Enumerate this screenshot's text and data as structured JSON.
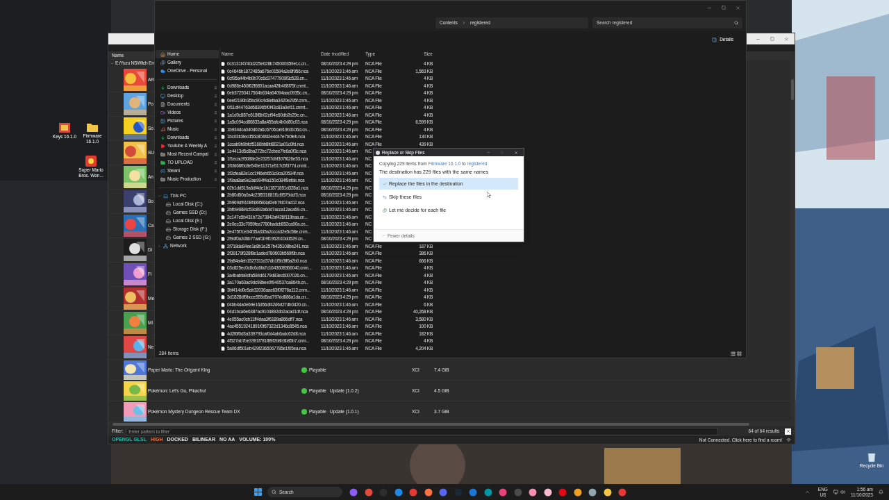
{
  "desktop_icons": [
    {
      "label": "Keys 16.1.0",
      "kind": "keys"
    },
    {
      "label": "Firmware 16.1.0",
      "kind": "folder"
    },
    {
      "label": "Super Mario Bros. Won...",
      "kind": "game"
    },
    {
      "label": "Recycle Bin",
      "kind": "bin"
    }
  ],
  "yuzu": {
    "header": "Name",
    "tree_root": "E:/Yuzu NSWitch En",
    "games_behind": [
      {
        "title": "AR"
      },
      {
        "title": "Po"
      },
      {
        "title": "So"
      },
      {
        "title": "SU"
      },
      {
        "title": "An"
      },
      {
        "title": "Bo"
      },
      {
        "title": "Ca"
      },
      {
        "title": "Di"
      },
      {
        "title": "Fi"
      },
      {
        "title": "Me"
      },
      {
        "title": "Mi"
      },
      {
        "title": "Ne"
      }
    ],
    "games": [
      {
        "title": "Paper Mario: The Origami King",
        "compatibility": "Playable",
        "color": "#43c443",
        "file_type": "XCI",
        "size": "7.4 GiB"
      },
      {
        "title": "Pokémon: Let's Go, Pikachu!",
        "compatibility": "Playable",
        "color": "#43c443",
        "addons": "Update (1.0.2)",
        "file_type": "XCI",
        "size": "4.5 GiB"
      },
      {
        "title": "Pokémon Mystery Dungeon Rescue Team DX",
        "compatibility": "Playable",
        "color": "#43c443",
        "addons": "Update (1.0.1)",
        "file_type": "XCI",
        "size": "3.7 GiB"
      }
    ],
    "filter": {
      "label": "Filter:",
      "placeholder": "Enter pattern to filter",
      "results": "64 of 64 results"
    },
    "status": [
      {
        "text": "OPENGL GLSL",
        "color": "#2fb6a8"
      },
      {
        "text": "HIGH",
        "color": "#e8713a"
      },
      {
        "text": "DOCKED",
        "color": "#e6e6e6"
      },
      {
        "text": "BILINEAR",
        "color": "#e6e6e6"
      },
      {
        "text": "NO AA",
        "color": "#e6e6e6"
      },
      {
        "text": "VOLUME: 100%",
        "color": "#e6e6e6"
      }
    ],
    "network": "Not Connected. Click here to find a room!"
  },
  "explorer": {
    "breadcrumb": [
      "Contents",
      "registered"
    ],
    "search_placeholder": "Search registered",
    "details_button": "Details",
    "sidebar": {
      "items": [
        {
          "label": "Home",
          "kind": "home",
          "selected": true,
          "pinned": false
        },
        {
          "label": "Gallery",
          "kind": "gallery",
          "selected": false,
          "pinned": false
        },
        {
          "label": "OneDrive - Personal",
          "kind": "cloud",
          "selected": false,
          "pinned": false
        },
        {
          "label": "Downloads",
          "kind": "download",
          "selected": false,
          "pinned": true
        },
        {
          "label": "Desktop",
          "kind": "desktop",
          "selected": false,
          "pinned": true
        },
        {
          "label": "Documents",
          "kind": "documents",
          "selected": false,
          "pinned": true
        },
        {
          "label": "Videos",
          "kind": "videos",
          "selected": false,
          "pinned": true
        },
        {
          "label": "Pictures",
          "kind": "pictures",
          "selected": false,
          "pinned": true
        },
        {
          "label": "Music",
          "kind": "music",
          "selected": false,
          "pinned": true
        },
        {
          "label": "Downloads",
          "kind": "download",
          "selected": false,
          "pinned": true
        },
        {
          "label": "Youtube & Weebly A",
          "kind": "video_folder",
          "selected": false,
          "pinned": true
        },
        {
          "label": "Most Recent Campai",
          "kind": "folder",
          "selected": false,
          "pinned": true
        },
        {
          "label": "TO UPLOAD",
          "kind": "green_folder",
          "selected": false,
          "pinned": true
        },
        {
          "label": "Steam",
          "kind": "steam",
          "selected": false,
          "pinned": true
        },
        {
          "label": "Music Production",
          "kind": "folder",
          "selected": false,
          "pinned": true
        }
      ],
      "tree": [
        {
          "label": "This PC",
          "kind": "pc",
          "expanded": true,
          "children": [
            {
              "label": "Local Disk (C:)"
            },
            {
              "label": "Games SSD (D:)"
            },
            {
              "label": "Local Disk (E:)"
            },
            {
              "label": "Storage Disk (F:)"
            },
            {
              "label": "Games 2 SSD (G:)"
            }
          ]
        },
        {
          "label": "Network",
          "kind": "network",
          "expanded": false
        }
      ]
    },
    "columns": [
      "Name",
      "Date modified",
      "Type",
      "Size"
    ],
    "files": [
      {
        "name": "0c3131f4740d225e028b745000359e1c.cn...",
        "date": "08/10/2023 4:29 pm",
        "type": "NCA File",
        "size": "4 KB"
      },
      {
        "name": "0c4646b1872485a676e01584a2e8f956.nca",
        "date": "11/10/2023 1:46 am",
        "type": "NCA File",
        "size": "1,563 KB"
      },
      {
        "name": "0cf95a44b4b0b70c6d37477909f3c528.cn...",
        "date": "11/10/2023 1:46 am",
        "type": "NCA File",
        "size": "4 KB"
      },
      {
        "name": "0d986e450f62f6801acaa42fb408f75f.cnmt...",
        "date": "11/10/2023 1:46 am",
        "type": "NCA File",
        "size": "4 KB"
      },
      {
        "name": "0eb37253417564b634a64094aac0935c.cn...",
        "date": "08/10/2023 4:29 pm",
        "type": "NCA File",
        "size": "4 KB"
      },
      {
        "name": "0eef2190b35bc90c4d8efaa3420e295f.cnm...",
        "date": "11/10/2023 1:46 am",
        "type": "NCA File",
        "size": "4 KB"
      },
      {
        "name": "0f11df44763d683965f0f43c83a0ef11.cnmt...",
        "date": "11/10/2023 1:46 am",
        "type": "NCA File",
        "size": "4 KB"
      },
      {
        "name": "1a1d0c887e618f8b02cf94e60db2b29e.cn...",
        "date": "11/10/2023 1:46 am",
        "type": "NCA File",
        "size": "4 KB"
      },
      {
        "name": "1a5c094cd86833a8a455afc4b0d80c03.nca",
        "date": "08/10/2023 4:29 pm",
        "type": "NCA File",
        "size": "6,599 KB"
      },
      {
        "name": "1b934dca040d02a6c6706ca919b3106d.cn...",
        "date": "08/10/2023 4:29 pm",
        "type": "NCA File",
        "size": "4 KB"
      },
      {
        "name": "1bc03fc8ecd56c804fd2e4d47e7b0feb.nca",
        "date": "11/10/2023 1:46 am",
        "type": "NCA File",
        "size": "130 KB"
      },
      {
        "name": "1ccab9b9bfcf5160bb8fd8021a01c0fd.nca",
        "date": "11/10/2023 1:46 am",
        "type": "NCA File",
        "size": "439 KB"
      },
      {
        "name": "1e4413d5c8ba272bc72cbee7fe6a0f3c.nca",
        "date": "11/10/2023 1:46 am",
        "type": "NC"
      },
      {
        "name": "1f1ecac95088e2e23257dbf307f626e53.nca",
        "date": "11/10/2023 1:46 am",
        "type": "NC"
      },
      {
        "name": "1f1fd68f0c8e549e11371e517c5f377d.cnmt...",
        "date": "11/10/2023 1:46 am",
        "type": "NC"
      },
      {
        "name": "1f2cfea82e1cc1f46eb651c9ca20534f.nca",
        "date": "11/10/2023 1:46 am",
        "type": "NC"
      },
      {
        "name": "1f9aa8ae9e2ae994f4a150c084f8efde.nca",
        "date": "11/10/2023 1:46 am",
        "type": "NC"
      },
      {
        "name": "02b1dd519a6df4de1b11871851d328a1.nca",
        "date": "08/10/2023 4:29 pm",
        "type": "NC"
      },
      {
        "name": "2b80d50a0a4c23f531681f1d9579dcf3.nca",
        "date": "08/10/2023 4:29 pm",
        "type": "NC"
      },
      {
        "name": "2b969df9108f489583af2eb7fd07ac02.nca",
        "date": "11/10/2023 1:46 am",
        "type": "NC"
      },
      {
        "name": "2bfb94884c53c892a6dd7acca12aca59.cn...",
        "date": "11/10/2023 1:46 am",
        "type": "NC"
      },
      {
        "name": "2c147e5b431b72e73842af426f119baa.cn...",
        "date": "11/10/2023 1:46 am",
        "type": "NC"
      },
      {
        "name": "2e0ec33c7059fea7780badcb852ca90a.cn...",
        "date": "11/10/2023 1:46 am",
        "type": "NC"
      },
      {
        "name": "2e475f7ce34f35a335a2ccca32e5c58e.cnm...",
        "date": "11/10/2023 1:46 am",
        "type": "NC"
      },
      {
        "name": "2f9df0a2d6b77aaf1b9f1952b10dd529.cn...",
        "date": "08/10/2023 4:29 pm",
        "type": "NC"
      },
      {
        "name": "2f718de84ee1e8b1e257b435108be241.nca",
        "date": "11/10/2023 1:46 am",
        "type": "NCA File",
        "size": "187 KB"
      },
      {
        "name": "2f39179f328f8e1aded780603b569f9b.nca",
        "date": "11/10/2023 1:46 am",
        "type": "NCA File",
        "size": "386 KB"
      },
      {
        "name": "2fa84a4eb1527311d37db1f5b3ff6a2b0.nca",
        "date": "11/10/2023 1:46 am",
        "type": "NCA File",
        "size": "666 KB"
      },
      {
        "name": "03c825ec0c8c6c6fa7c1643608366040.cnm...",
        "date": "11/10/2023 1:46 am",
        "type": "NCA File",
        "size": "4 KB"
      },
      {
        "name": "3a4babfa9dfa584d6179d83ec6007026.cn...",
        "date": "11/10/2023 1:46 am",
        "type": "NCA File",
        "size": "4 KB"
      },
      {
        "name": "3a170a63ac9dc98bee0f940537ca864b.cn...",
        "date": "08/10/2023 4:29 pm",
        "type": "NCA File",
        "size": "4 KB"
      },
      {
        "name": "3bf414d0e5ab32036aae63f0f276a112.cnm...",
        "date": "11/10/2023 1:46 am",
        "type": "NCA File",
        "size": "4 KB"
      },
      {
        "name": "3d1828df9bcce555d5ad797dd686a1da.cn...",
        "date": "08/10/2023 4:29 pm",
        "type": "NCA File",
        "size": "4 KB"
      },
      {
        "name": "04bb4da0e69e16d56df42d6d27db0d20.cn...",
        "date": "11/10/2023 1:46 am",
        "type": "NCA File",
        "size": "6 KB"
      },
      {
        "name": "04d1bca6e6387ac9103892db2acad1df.nca",
        "date": "08/10/2023 4:29 pm",
        "type": "NCA File",
        "size": "40,268 KB"
      },
      {
        "name": "4e055ac0cb11ff4daa3f6189a866dff7.nca",
        "date": "11/10/2023 1:46 am",
        "type": "NCA File",
        "size": "3,580 KB"
      },
      {
        "name": "4ac45519241891f0f67322d1346c8545.nca",
        "date": "11/10/2023 1:46 am",
        "type": "NCA File",
        "size": "100 KB"
      },
      {
        "name": "4d2f6f0d3a339793caf0d4ab6adc62d8.nca",
        "date": "11/10/2023 1:46 am",
        "type": "NCA File",
        "size": "182 KB"
      },
      {
        "name": "4f527ab7be3391f781f89f2b8b3b85b7.cnm...",
        "date": "08/10/2023 4:29 pm",
        "type": "NCA File",
        "size": "4 KB"
      },
      {
        "name": "5a06df501eb429f2365067785e1f05ea.nca",
        "date": "11/10/2023 1:46 am",
        "type": "NCA File",
        "size": "4,204 KB"
      }
    ],
    "status": "284 items"
  },
  "dialog": {
    "title": "Replace or Skip Files",
    "copying": {
      "prefix": "Copying 229 items from",
      "source": "Firmware 16.1.0",
      "middle": "to",
      "target": "registered"
    },
    "message": "The destination has 229 files with the same names",
    "options": [
      {
        "label": "Replace the files in the destination",
        "kind": "replace",
        "selected": true
      },
      {
        "label": "Skip these files",
        "kind": "skip",
        "selected": false
      },
      {
        "label": "Let me decide for each file",
        "kind": "decide",
        "selected": false
      }
    ],
    "details_toggle": "Fewer details"
  },
  "taskbar": {
    "search": "Search",
    "language": [
      "ENG",
      "US"
    ],
    "time": "1:56 am",
    "date": "11/10/2023"
  }
}
